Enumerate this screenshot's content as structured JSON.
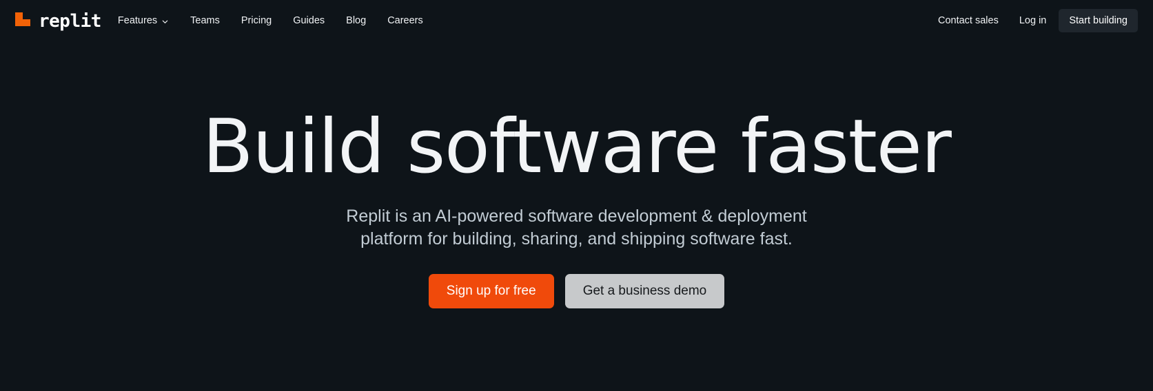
{
  "theme": {
    "background": "#0e1419",
    "brand_orange": "#F26207",
    "cta_orange": "#F04A0B",
    "text_primary": "#f2f4f6",
    "text_secondary": "#c2ccd4",
    "nav_button_bg": "#1f262d",
    "secondary_button_bg": "#c7c9cb"
  },
  "navbar": {
    "brand": {
      "name": "replit",
      "logo_icon": "replit-logo-icon"
    },
    "links": [
      {
        "label": "Features",
        "has_dropdown": true,
        "icon": "chevron-down-icon"
      },
      {
        "label": "Teams",
        "has_dropdown": false
      },
      {
        "label": "Pricing",
        "has_dropdown": false
      },
      {
        "label": "Guides",
        "has_dropdown": false
      },
      {
        "label": "Blog",
        "has_dropdown": false
      },
      {
        "label": "Careers",
        "has_dropdown": false
      }
    ],
    "right": {
      "contact_sales": "Contact sales",
      "log_in": "Log in",
      "start_building": "Start building"
    }
  },
  "hero": {
    "title": "Build software faster",
    "subtitle_line1": "Replit is an AI-powered software development & deployment platform for",
    "subtitle_line2": "building, sharing, and shipping software fast.",
    "primary_cta": "Sign up for free",
    "secondary_cta": "Get a business demo"
  }
}
